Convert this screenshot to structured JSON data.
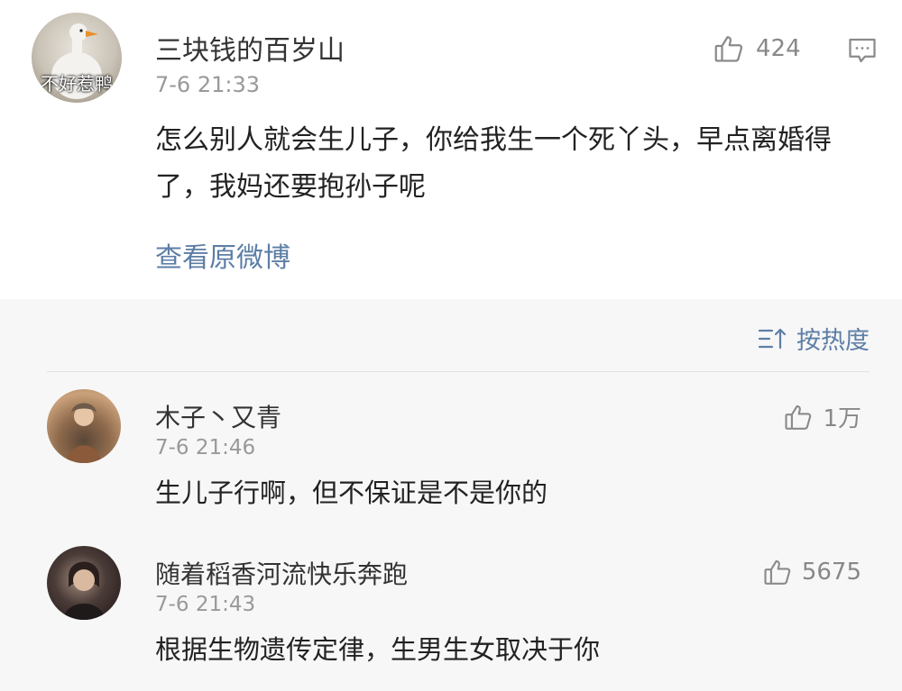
{
  "post": {
    "avatar_caption": "不好惹鸭",
    "username": "三块钱的百岁山",
    "timestamp": "7-6 21:33",
    "likes": "424",
    "text": "怎么别人就会生儿子，你给我生一个死丫头，早点离婚得了，我妈还要抱孙子呢",
    "view_original": "查看原微博"
  },
  "sort": {
    "label": "按热度"
  },
  "replies": [
    {
      "username": "木子丶又青",
      "timestamp": "7-6 21:46",
      "likes": "1万",
      "text": "生儿子行啊，但不保证是不是你的"
    },
    {
      "username": "随着稻香河流快乐奔跑",
      "timestamp": "7-6 21:43",
      "likes": "5675",
      "text": "根据生物遗传定律，生男生女取决于你"
    }
  ],
  "colors": {
    "link": "#5d7ea6",
    "muted": "#999999",
    "reply_bg": "#f7f7f7"
  },
  "icons": {
    "like": "thumbs-up-icon",
    "comment": "comment-icon",
    "sort": "sort-icon"
  }
}
